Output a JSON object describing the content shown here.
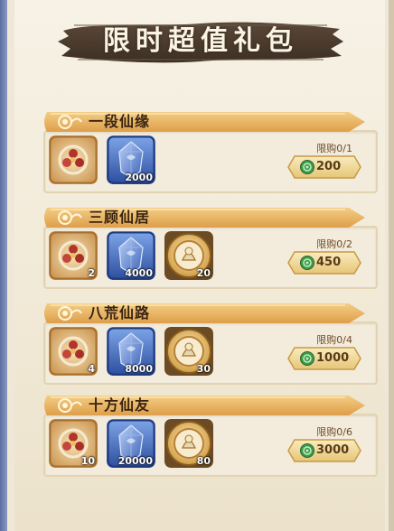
{
  "title": "限时超值礼包",
  "packs": [
    {
      "name": "一段仙缘",
      "limit": "限购0/1",
      "price": "200",
      "items": [
        {
          "icon": "rose-charm-icon",
          "count": ""
        },
        {
          "icon": "blue-crystal-icon",
          "count": "2000"
        }
      ]
    },
    {
      "name": "三顾仙居",
      "limit": "限购0/2",
      "price": "450",
      "items": [
        {
          "icon": "rose-charm-icon",
          "count": "2"
        },
        {
          "icon": "blue-crystal-icon",
          "count": "4000"
        },
        {
          "icon": "gold-token-icon",
          "count": "20"
        }
      ]
    },
    {
      "name": "八荒仙路",
      "limit": "限购0/4",
      "price": "1000",
      "items": [
        {
          "icon": "rose-charm-icon",
          "count": "4"
        },
        {
          "icon": "blue-crystal-icon",
          "count": "8000"
        },
        {
          "icon": "gold-token-icon",
          "count": "30"
        }
      ]
    },
    {
      "name": "十方仙友",
      "limit": "限购0/6",
      "price": "3000",
      "items": [
        {
          "icon": "rose-charm-icon",
          "count": "10"
        },
        {
          "icon": "blue-crystal-icon",
          "count": "20000"
        },
        {
          "icon": "gold-token-icon",
          "count": "80"
        }
      ]
    }
  ],
  "colors": {
    "header_ribbon": "#e9b867",
    "title_banner": "#4a3a30",
    "price_button": "#f0dca0",
    "coin": "#3f9a4a"
  }
}
